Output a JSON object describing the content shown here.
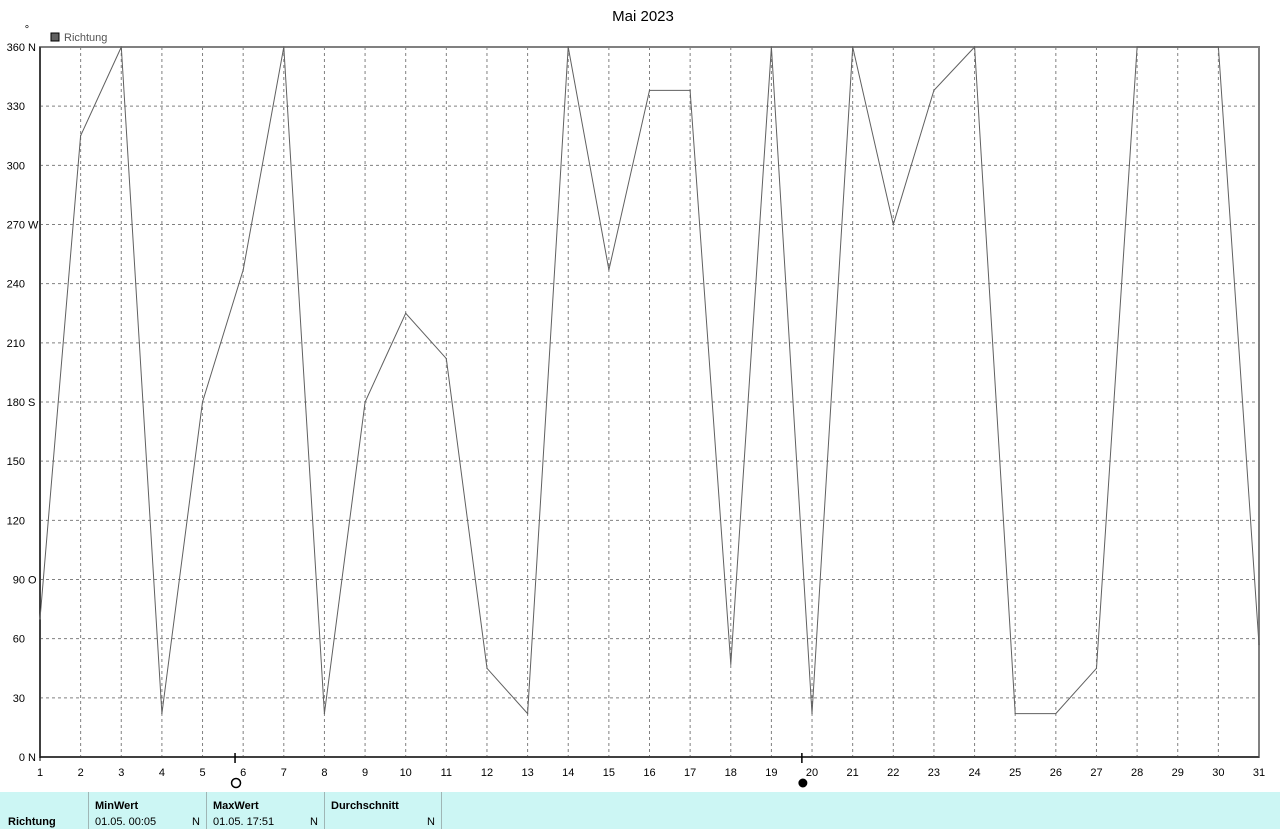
{
  "chart_data": {
    "type": "line",
    "title": "Mai 2023",
    "unit_label": "°",
    "legend": [
      {
        "name": "Richtung",
        "color": "#606060"
      }
    ],
    "x_ticks": [
      "1",
      "2",
      "3",
      "4",
      "5",
      "6",
      "7",
      "8",
      "9",
      "10",
      "11",
      "12",
      "13",
      "14",
      "15",
      "16",
      "17",
      "18",
      "19",
      "20",
      "21",
      "22",
      "23",
      "24",
      "25",
      "26",
      "27",
      "28",
      "29",
      "30",
      "31"
    ],
    "xlim": [
      1,
      31
    ],
    "ylim": [
      0,
      360
    ],
    "y_ticks": [
      {
        "value": 0,
        "label": "0",
        "dir": "N"
      },
      {
        "value": 30,
        "label": "30",
        "dir": ""
      },
      {
        "value": 60,
        "label": "60",
        "dir": ""
      },
      {
        "value": 90,
        "label": "90",
        "dir": "O"
      },
      {
        "value": 120,
        "label": "120",
        "dir": ""
      },
      {
        "value": 150,
        "label": "150",
        "dir": ""
      },
      {
        "value": 180,
        "label": "180",
        "dir": "S"
      },
      {
        "value": 210,
        "label": "210",
        "dir": ""
      },
      {
        "value": 240,
        "label": "240",
        "dir": ""
      },
      {
        "value": 270,
        "label": "270",
        "dir": "W"
      },
      {
        "value": 300,
        "label": "300",
        "dir": ""
      },
      {
        "value": 330,
        "label": "330",
        "dir": ""
      },
      {
        "value": 360,
        "label": "360",
        "dir": "N"
      }
    ],
    "grid": true,
    "series": [
      {
        "name": "Richtung",
        "color": "#606060",
        "points": [
          [
            1,
            70
          ],
          [
            2,
            315
          ],
          [
            3,
            360
          ],
          [
            4,
            22
          ],
          [
            5,
            180
          ],
          [
            6,
            247
          ],
          [
            7,
            360
          ],
          [
            8,
            22
          ],
          [
            9,
            180
          ],
          [
            10,
            225
          ],
          [
            11,
            202
          ],
          [
            12,
            45
          ],
          [
            13,
            22
          ],
          [
            14,
            360
          ],
          [
            15,
            247
          ],
          [
            16,
            338
          ],
          [
            17,
            338
          ],
          [
            18,
            47
          ],
          [
            19,
            360
          ],
          [
            20,
            22
          ],
          [
            21,
            360
          ],
          [
            22,
            270
          ],
          [
            23,
            338
          ],
          [
            24,
            360
          ],
          [
            25,
            22
          ],
          [
            26,
            22
          ],
          [
            27,
            45
          ],
          [
            28,
            360
          ],
          [
            29,
            360
          ],
          [
            30,
            360
          ],
          [
            31,
            57
          ]
        ]
      }
    ],
    "moon_phases": [
      {
        "day": 5.8,
        "phase": "full"
      },
      {
        "day": 19.75,
        "phase": "new"
      }
    ]
  },
  "stats": {
    "row_label": "Richtung",
    "min": {
      "header": "MinWert",
      "date": "01.05.  00:05",
      "value": "N"
    },
    "max": {
      "header": "MaxWert",
      "date": "01.05.  17:51",
      "value": "N"
    },
    "avg": {
      "header": "Durchschnitt",
      "date": "",
      "value": "N"
    }
  }
}
